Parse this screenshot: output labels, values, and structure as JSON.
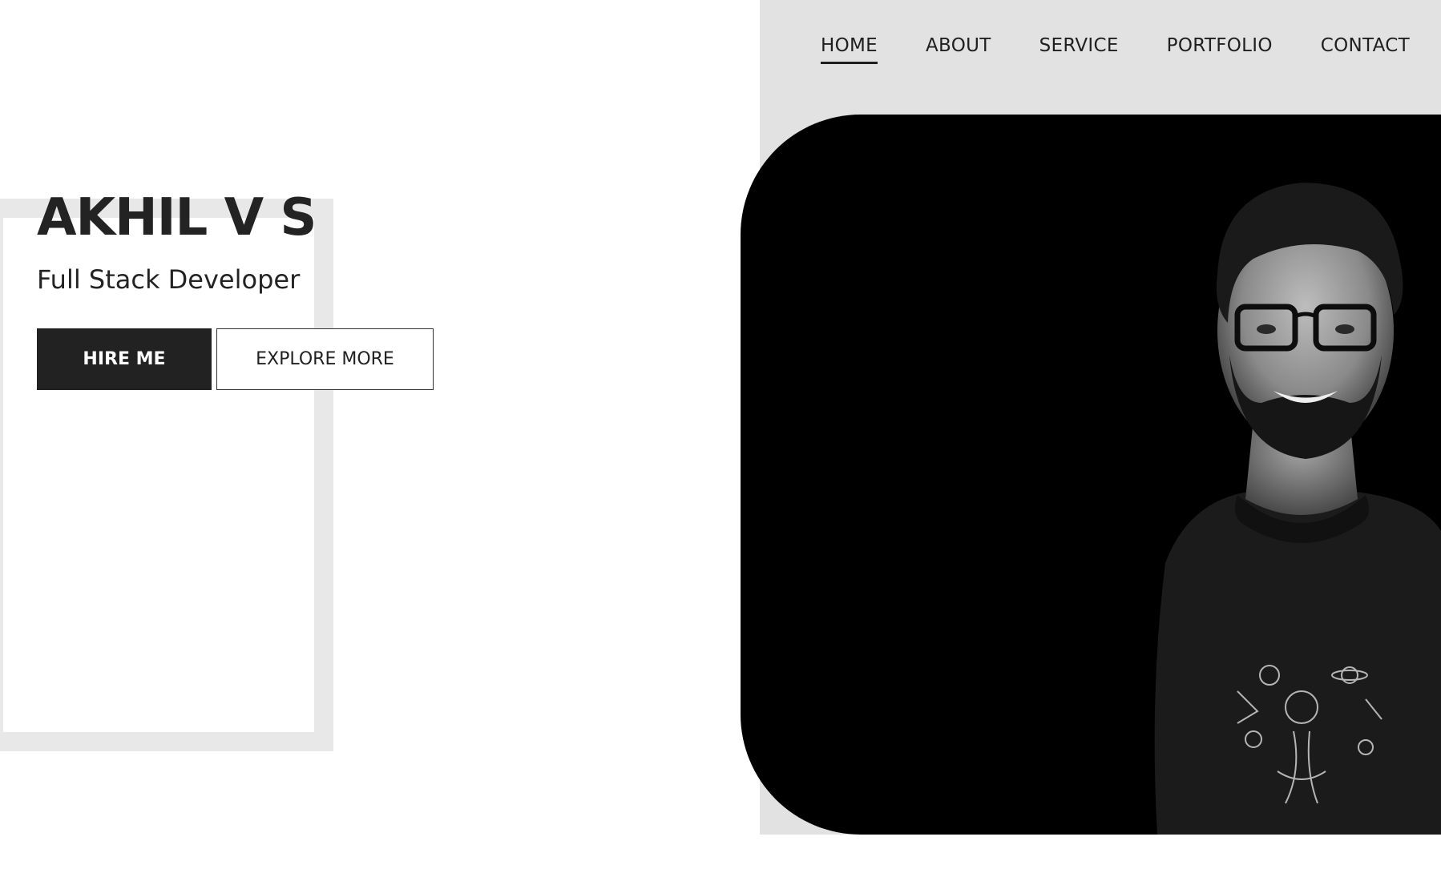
{
  "nav": {
    "items": [
      {
        "label": "HOME",
        "active": true
      },
      {
        "label": "ABOUT",
        "active": false
      },
      {
        "label": "SERVICE",
        "active": false
      },
      {
        "label": "PORTFOLIO",
        "active": false
      },
      {
        "label": "CONTACT",
        "active": false
      }
    ]
  },
  "hero": {
    "name": "AKHIL V S",
    "subtitle": "Full Stack Developer",
    "hire_label": "HIRE ME",
    "explore_label": "EXPLORE MORE"
  },
  "colors": {
    "panel": "#e2e2e2",
    "frame": "#e8e8e8",
    "dark": "#222222",
    "photo_bg": "#000000"
  }
}
